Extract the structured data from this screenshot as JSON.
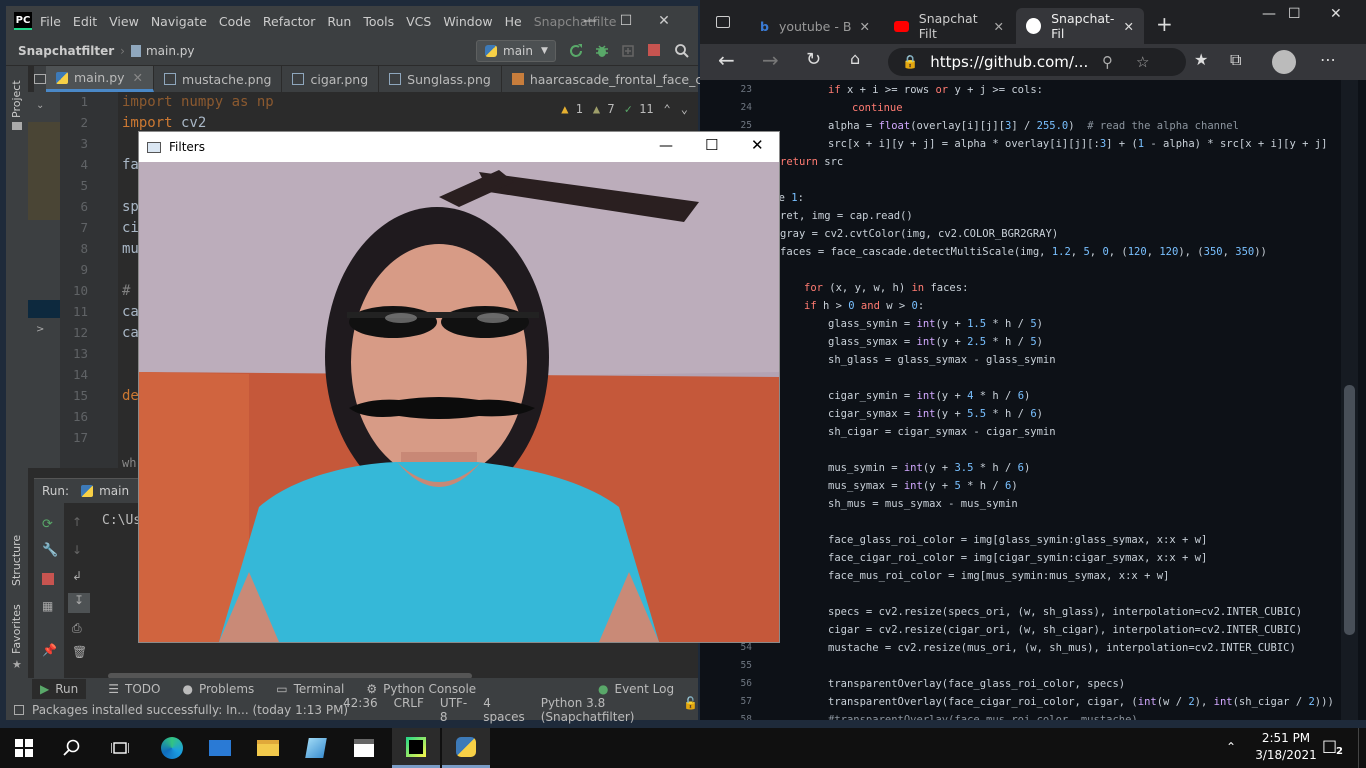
{
  "ide": {
    "logo": "PC",
    "menu": [
      "File",
      "Edit",
      "View",
      "Navigate",
      "Code",
      "Refactor",
      "Run",
      "Tools",
      "VCS",
      "Window",
      "He"
    ],
    "title": "Snapchatfilte",
    "breadcrumb_project": "Snapchatfilter",
    "breadcrumb_file": "main.py",
    "run_config": "main",
    "tabs": [
      "main.py",
      "mustache.png",
      "cigar.png",
      "Sunglass.png",
      "haarcascade_frontal_face_c"
    ],
    "inspections": {
      "warnings": "1",
      "weak_warnings": "7",
      "typos": "11"
    },
    "line_numbers": [
      "1",
      "2",
      "3",
      "4",
      "5",
      "6",
      "7",
      "8",
      "9",
      "10",
      "11",
      "12",
      "13",
      "14",
      "15",
      "16",
      "17"
    ],
    "code": {
      "l1": "import numpy as np",
      "l2_kw": "import",
      "l2_rest": " cv2",
      "l3": "fa",
      "l6": "sp",
      "l7": "ci",
      "l8": "mu",
      "l10": "#",
      "l11": "ca",
      "l12": "ca",
      "l15": "de",
      "bottom": "wh"
    },
    "strip_project": "Project",
    "strip_structure": "Structure",
    "strip_favorites": "Favorites",
    "run_label": "Run:",
    "run_tab": "main",
    "console_text": "C:\\Us",
    "bottom_tabs": [
      "Run",
      "TODO",
      "Problems",
      "Terminal",
      "Python Console"
    ],
    "event_log": "Event Log",
    "status_message": "Packages installed successfully: In... (today 1:13 PM)",
    "status_position": "42:36",
    "status_line_sep": "CRLF",
    "status_encoding": "UTF-8",
    "status_indent": "4 spaces",
    "status_interpreter": "Python 3.8 (Snapchatfilter)"
  },
  "browser": {
    "tabs": [
      "youtube - B",
      "Snapchat Filt",
      "Snapchat-Fil"
    ],
    "address": "https://github.com/...",
    "code_lines": [
      {
        "n": "23",
        "indent": 128,
        "t": "if x + i >= rows or y + j >= cols:"
      },
      {
        "n": "24",
        "indent": 152,
        "t": "continue"
      },
      {
        "n": "25",
        "indent": 128,
        "t": "alpha = float(overlay[i][j][3] / 255.0)  # read the alpha channel"
      },
      {
        "n": "26",
        "indent": 128,
        "t": "src[x + i][y + j] = alpha * overlay[i][j][:3] + (1 - alpha) * src[x + i][y + j]"
      },
      {
        "n": "27",
        "indent": 80,
        "t": "return src"
      },
      {
        "n": "28",
        "indent": 80,
        "t": ""
      },
      {
        "n": "29",
        "indent": 66,
        "t": "ile 1:"
      },
      {
        "n": "30",
        "indent": 80,
        "t": "ret, img = cap.read()"
      },
      {
        "n": "31",
        "indent": 80,
        "t": "gray = cv2.cvtColor(img, cv2.COLOR_BGR2GRAY)"
      },
      {
        "n": "32",
        "indent": 80,
        "t": "faces = face_cascade.detectMultiScale(img, 1.2, 5, 0, (120, 120), (350, 350))"
      },
      {
        "n": "33",
        "indent": 80,
        "t": ""
      },
      {
        "n": "34",
        "indent": 104,
        "t": "for (x, y, w, h) in faces:"
      },
      {
        "n": "35",
        "indent": 104,
        "t": "if h > 0 and w > 0:"
      },
      {
        "n": "36",
        "indent": 128,
        "t": "glass_symin = int(y + 1.5 * h / 5)"
      },
      {
        "n": "37",
        "indent": 128,
        "t": "glass_symax = int(y + 2.5 * h / 5)"
      },
      {
        "n": "38",
        "indent": 128,
        "t": "sh_glass = glass_symax - glass_symin"
      },
      {
        "n": "39",
        "indent": 128,
        "t": ""
      },
      {
        "n": "40",
        "indent": 128,
        "t": "cigar_symin = int(y + 4 * h / 6)"
      },
      {
        "n": "41",
        "indent": 128,
        "t": "cigar_symax = int(y + 5.5 * h / 6)"
      },
      {
        "n": "42",
        "indent": 128,
        "t": "sh_cigar = cigar_symax - cigar_symin"
      },
      {
        "n": "43",
        "indent": 128,
        "t": ""
      },
      {
        "n": "44",
        "indent": 128,
        "t": "mus_symin = int(y + 3.5 * h / 6)"
      },
      {
        "n": "45",
        "indent": 128,
        "t": "mus_symax = int(y + 5 * h / 6)"
      },
      {
        "n": "46",
        "indent": 128,
        "t": "sh_mus = mus_symax - mus_symin"
      },
      {
        "n": "47",
        "indent": 128,
        "t": ""
      },
      {
        "n": "48",
        "indent": 128,
        "t": "face_glass_roi_color = img[glass_symin:glass_symax, x:x + w]"
      },
      {
        "n": "49",
        "indent": 128,
        "t": "face_cigar_roi_color = img[cigar_symin:cigar_symax, x:x + w]"
      },
      {
        "n": "50",
        "indent": 128,
        "t": "face_mus_roi_color = img[mus_symin:mus_symax, x:x + w]"
      },
      {
        "n": "51",
        "indent": 128,
        "t": ""
      },
      {
        "n": "52",
        "indent": 128,
        "t": "specs = cv2.resize(specs_ori, (w, sh_glass), interpolation=cv2.INTER_CUBIC)"
      },
      {
        "n": "53",
        "indent": 128,
        "t": "cigar = cv2.resize(cigar_ori, (w, sh_cigar), interpolation=cv2.INTER_CUBIC)"
      },
      {
        "n": "54",
        "indent": 128,
        "t": "mustache = cv2.resize(mus_ori, (w, sh_mus), interpolation=cv2.INTER_CUBIC)"
      },
      {
        "n": "55",
        "indent": 128,
        "t": ""
      },
      {
        "n": "56",
        "indent": 128,
        "t": "transparentOverlay(face_glass_roi_color, specs)"
      },
      {
        "n": "57",
        "indent": 128,
        "t": "transparentOverlay(face_cigar_roi_color, cigar, (int(w / 2), int(sh_cigar / 2)))"
      },
      {
        "n": "58",
        "indent": 128,
        "t": "#transparentOverlay(face_mus_roi_color, mustache)"
      }
    ]
  },
  "filters": {
    "title": "Filters"
  },
  "taskbar": {
    "time": "2:51 PM",
    "date": "3/18/2021",
    "notifications": "2"
  }
}
